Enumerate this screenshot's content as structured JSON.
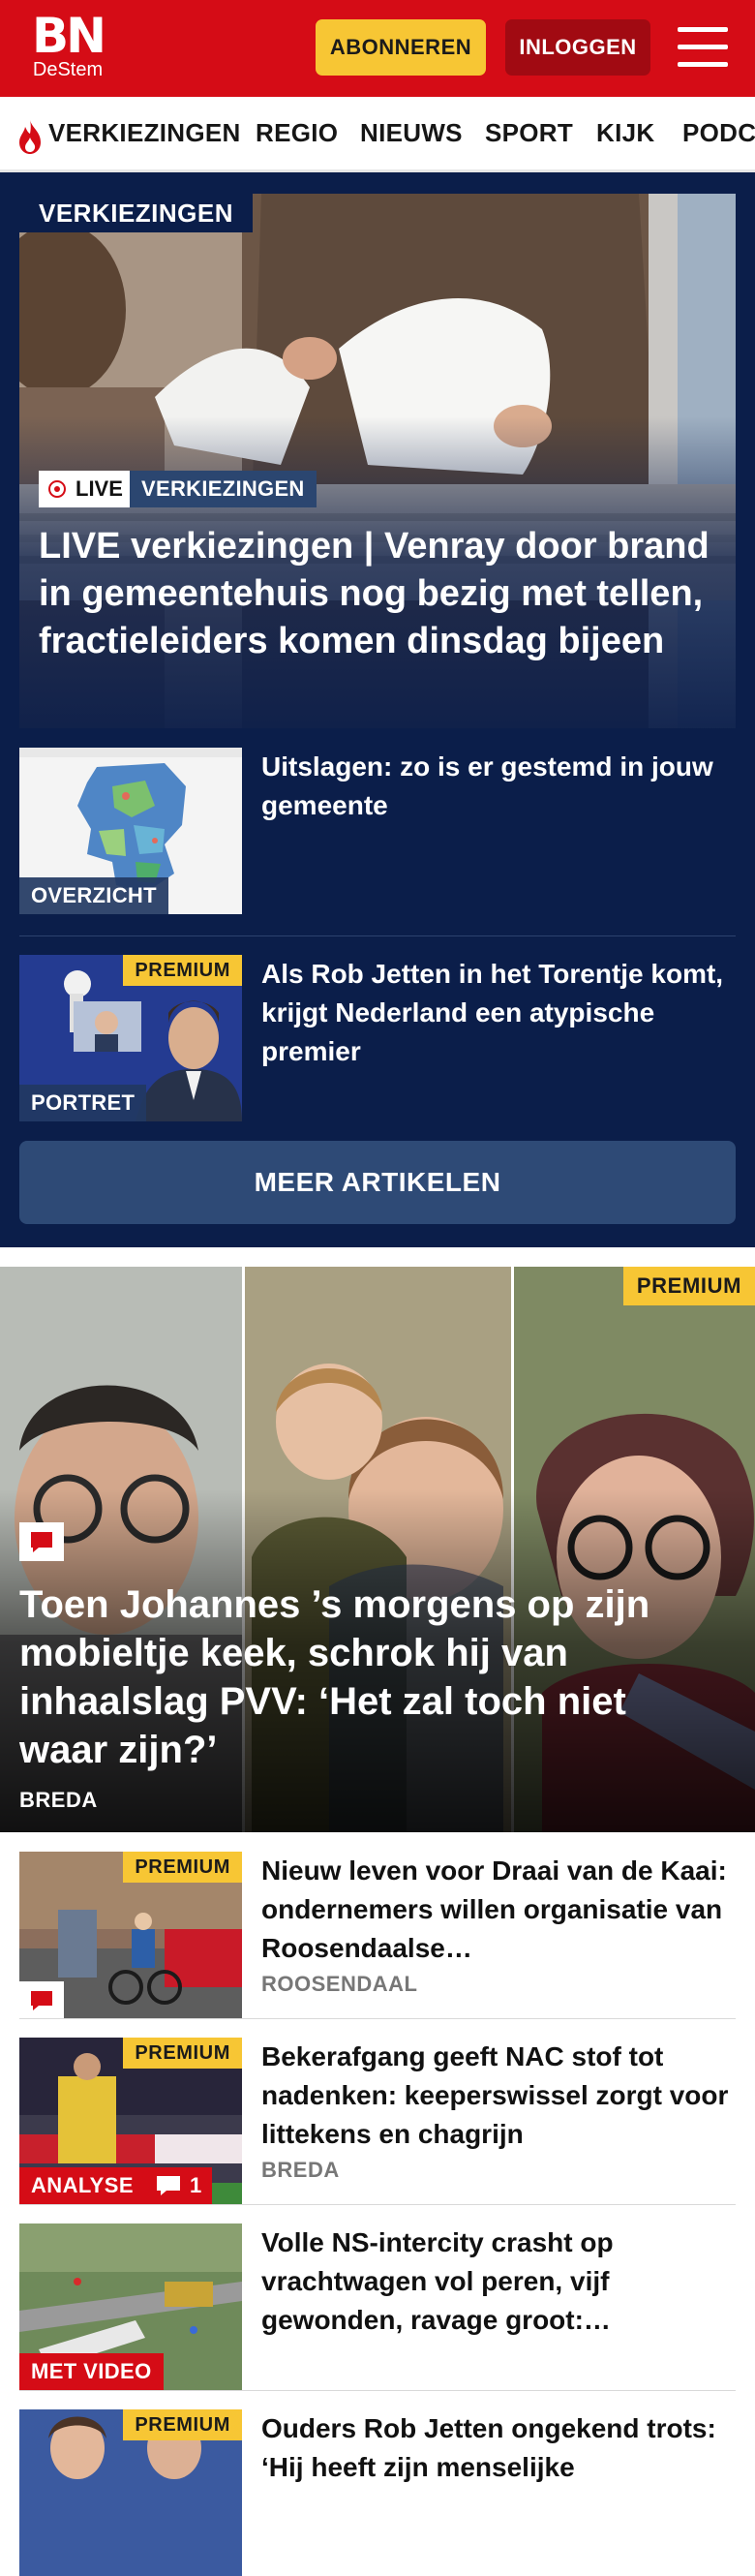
{
  "header": {
    "logo_main": "BN",
    "logo_sub": "DeStem",
    "subscribe_label": "ABONNEREN",
    "login_label": "INLOGGEN"
  },
  "nav": {
    "items": [
      {
        "label": "VERKIEZINGEN",
        "icon": "flame-icon"
      },
      {
        "label": "REGIO"
      },
      {
        "label": "NIEUWS"
      },
      {
        "label": "SPORT"
      },
      {
        "label": "KIJK"
      },
      {
        "label": "PODCASTS"
      }
    ]
  },
  "election": {
    "section_label": "VERKIEZINGEN",
    "hero": {
      "live_label": "LIVE",
      "category": "VERKIEZINGEN",
      "title": "LIVE verkiezingen | Venray door brand in gemeentehuis nog bezig met tellen, fractieleiders komen dinsdag bijeen"
    },
    "items": [
      {
        "label": "OVERZICHT",
        "title": "Uitslagen: zo is er gestemd in jouw gemeente"
      },
      {
        "label": "PORTRET",
        "premium": "PREMIUM",
        "title": "Als Rob Jetten in het Torentje komt, krijgt Nederland een atypische premier"
      }
    ],
    "more_label": "MEER ARTIKELEN"
  },
  "feature": {
    "premium": "PREMIUM",
    "title": "Toen Johannes ’s morgens op zijn mobieltje keek, schrok hij van inhaalslag PVV: ‘Het zal toch niet waar zijn?’",
    "location": "BREDA"
  },
  "news": [
    {
      "premium": "PREMIUM",
      "title": "Nieuw leven voor Draai van de Kaai: ondernemers willen organisatie van Roosendaalse…",
      "location": "ROOSENDAAL"
    },
    {
      "premium": "PREMIUM",
      "label": "ANALYSE",
      "comments": "1",
      "title": "Bekerafgang geeft NAC stof tot nadenken: keeperswissel zorgt voor littekens en chagrijn",
      "location": "BREDA"
    },
    {
      "label": "MET VIDEO",
      "title": "Volle NS-intercity crasht op vrachtwagen vol peren, vijf gewonden, ravage groot:…"
    },
    {
      "premium": "PREMIUM",
      "title": "Ouders Rob Jetten ongekend trots: ‘Hij heeft zijn menselijke"
    }
  ],
  "colors": {
    "brand_red": "#d50c16",
    "navy": "#0b1e4a",
    "premium_yellow": "#f7c634"
  }
}
